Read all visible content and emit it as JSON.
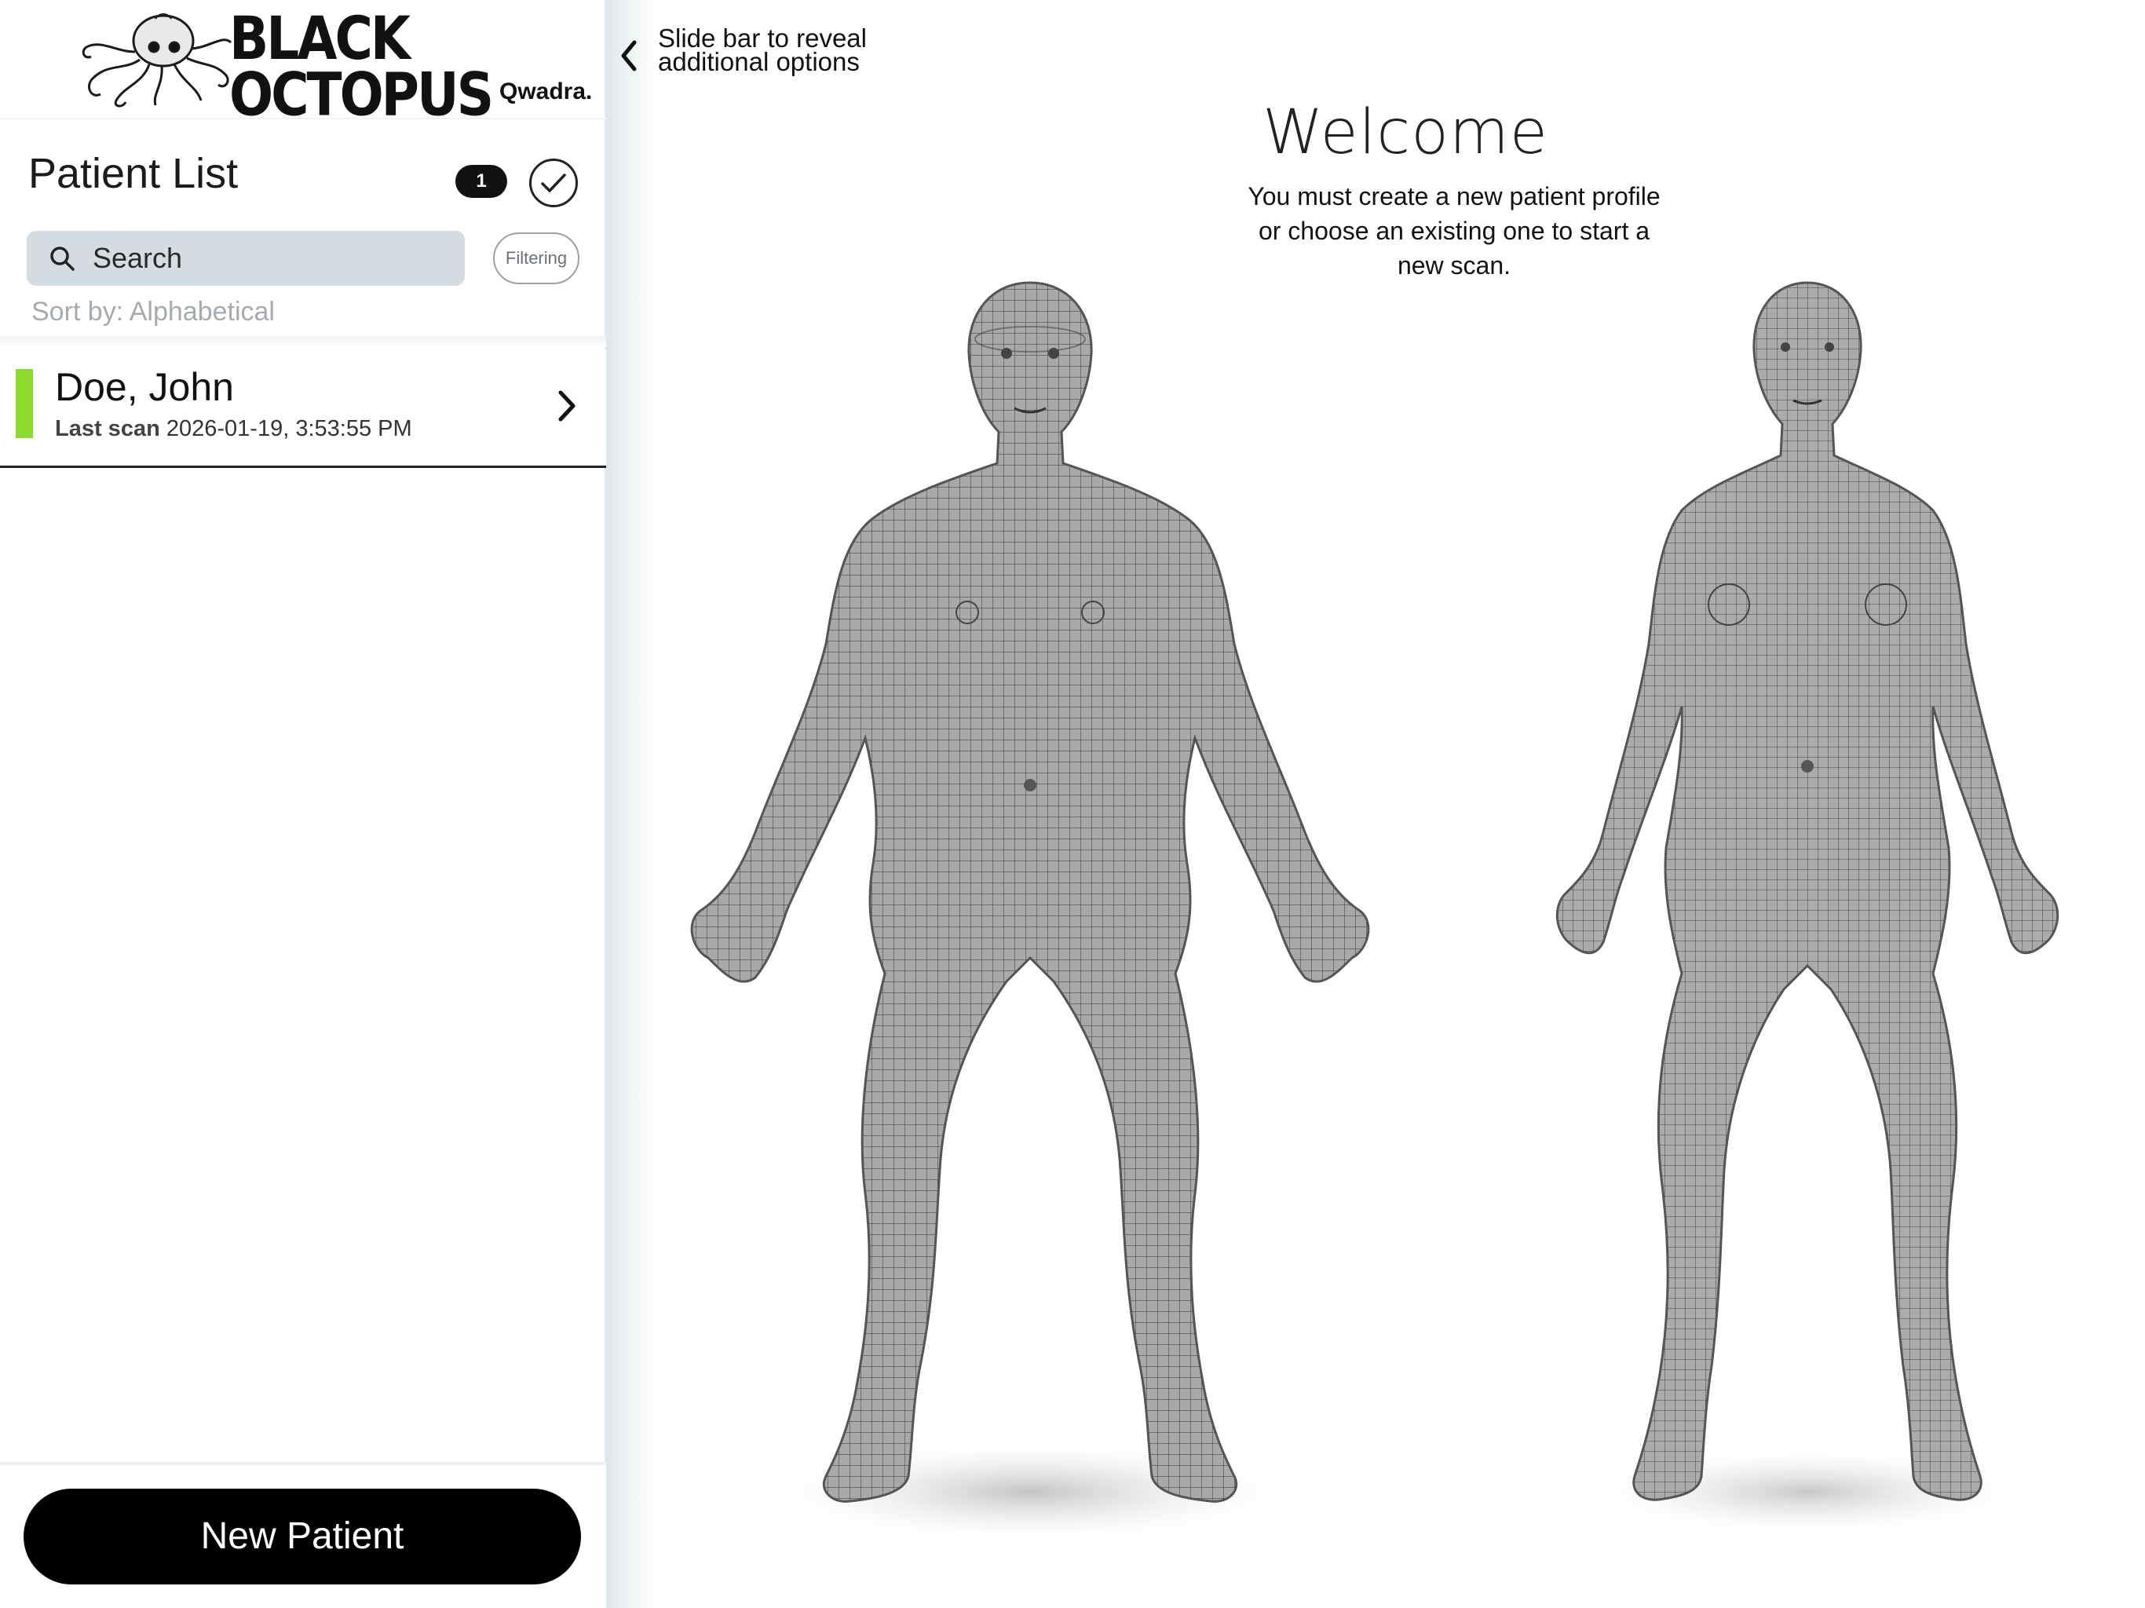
{
  "brand": {
    "logo_line1": "BLACK",
    "logo_line2": "OCTOPUS",
    "partner": "Qwadra."
  },
  "sidebar": {
    "title": "Patient List",
    "patient_count": "1",
    "search": {
      "placeholder": "Search",
      "value": ""
    },
    "filter_label": "Filtering",
    "sort_label": "Sort by: Alphabetical",
    "patients": [
      {
        "name": "Doe, John",
        "last_scan_label": "Last scan",
        "last_scan_value": "2026-01-19, 3:53:55 PM",
        "status_color": "#8bdc2c"
      }
    ],
    "new_patient_label": "New Patient"
  },
  "main": {
    "slide_hint_line1": "Slide bar to reveal",
    "slide_hint_line2": "additional options",
    "welcome_title": "Welcome",
    "welcome_message": "You must create a new patient profile or choose an existing one to start a new scan."
  },
  "colors": {
    "accent": "#000000",
    "status_active": "#8bdc2c",
    "search_bg": "#d5dde2"
  }
}
